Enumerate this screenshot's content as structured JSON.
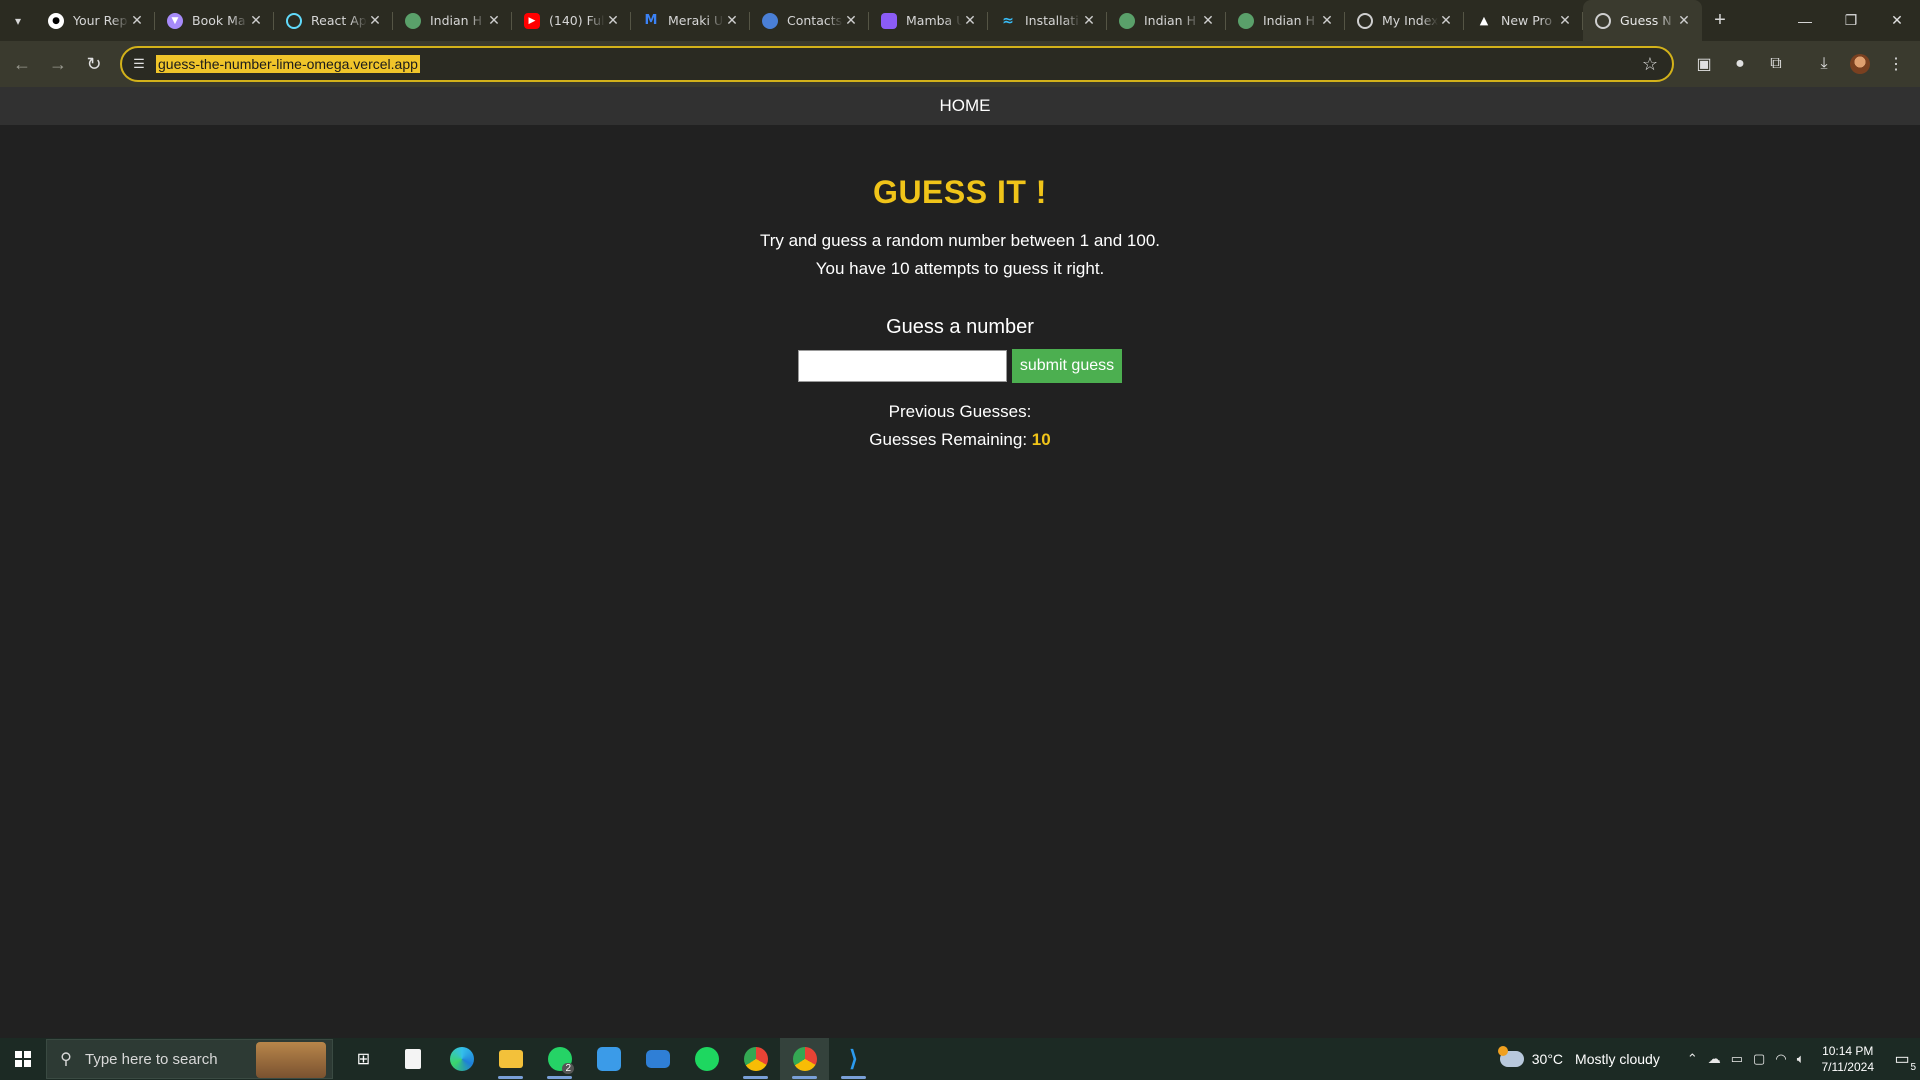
{
  "browser": {
    "tabs": [
      {
        "title": "Your Rep",
        "favicon": "github-icon",
        "color": "#ffffff"
      },
      {
        "title": "Book Ma",
        "favicon": "vite-icon",
        "color": "#a78bfa"
      },
      {
        "title": "React Ap",
        "favicon": "react-icon",
        "color": "#61dafb"
      },
      {
        "title": "Indian H",
        "favicon": "globe-icon",
        "color": "#5aa06a"
      },
      {
        "title": "(140) Full",
        "favicon": "youtube-icon",
        "color": "#ff0000"
      },
      {
        "title": "Meraki U",
        "favicon": "meraki-icon",
        "color": "#3b82f6"
      },
      {
        "title": "Contacts",
        "favicon": "contacts-icon",
        "color": "#4a7fd6"
      },
      {
        "title": "Mamba U",
        "favicon": "mamba-icon",
        "color": "#8b5cf6"
      },
      {
        "title": "Installati",
        "favicon": "tailwind-icon",
        "color": "#38bdf8"
      },
      {
        "title": "Indian H",
        "favicon": "globe-icon",
        "color": "#5aa06a"
      },
      {
        "title": "Indian H",
        "favicon": "globe-icon",
        "color": "#5aa06a"
      },
      {
        "title": "My Index",
        "favicon": "globe-icon",
        "color": "#cfcfcf"
      },
      {
        "title": "New Pro",
        "favicon": "vercel-icon",
        "color": "#ffffff"
      },
      {
        "title": "Guess N",
        "favicon": "globe-icon",
        "color": "#cfcfcf",
        "active": true
      }
    ],
    "url": "guess-the-number-lime-omega.vercel.app"
  },
  "page": {
    "nav_home": "HOME",
    "title": "GUESS IT !",
    "description_line1": "Try and guess a random number between 1 and 100.",
    "description_line2": "You have 10 attempts to guess it right.",
    "guess_label": "Guess a number",
    "guess_input_value": "",
    "submit_label": "submit guess",
    "previous_guesses_label": "Previous Guesses:",
    "remaining_label": "Guesses Remaining: ",
    "remaining_count": "10",
    "accent_color": "#f0c419",
    "button_color": "#4caf50"
  },
  "taskbar": {
    "search_placeholder": "Type here to search",
    "apps": [
      "task-view-icon",
      "notepad-icon",
      "edge-icon",
      "file-explorer-icon",
      "whatsapp-icon",
      "ms-store-icon",
      "mail-icon",
      "spotify-icon",
      "chrome-icon",
      "chrome-icon",
      "vscode-icon"
    ],
    "whatsapp_badge": "2",
    "weather_temp": "30°C",
    "weather_desc": "Mostly cloudy",
    "time": "10:14 PM",
    "date": "7/11/2024",
    "notification_count": "5"
  }
}
